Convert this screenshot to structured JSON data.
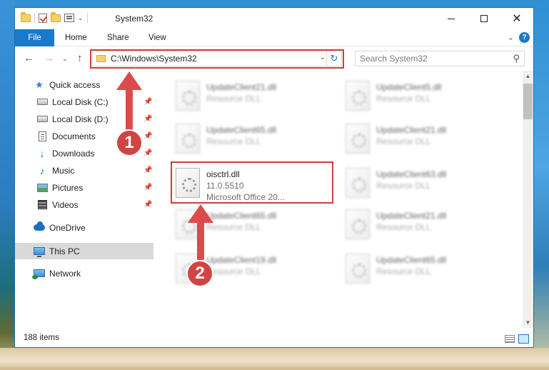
{
  "window": {
    "title": "System32",
    "minimize_glyph": "",
    "maximize_glyph": "",
    "close_glyph": "✕"
  },
  "ribbon": {
    "tabs": [
      {
        "label": "File",
        "active": true
      },
      {
        "label": "Home"
      },
      {
        "label": "Share"
      },
      {
        "label": "View"
      }
    ],
    "expand_glyph": "⌄",
    "help_glyph": "?"
  },
  "navigation": {
    "back_glyph": "←",
    "forward_glyph": "→",
    "recent_glyph": "⌄",
    "up_glyph": "↑",
    "address": "C:\\Windows\\System32",
    "address_dropdown_glyph": "⌄",
    "refresh_glyph": "↻",
    "search_placeholder": "Search System32",
    "search_glyph": "⚲"
  },
  "sidebar": {
    "items": [
      {
        "label": "Quick access",
        "icon": "star-icon"
      },
      {
        "label": "Local Disk (C:)",
        "icon": "drive-icon",
        "pinned": true
      },
      {
        "label": "Local Disk (D:)",
        "icon": "drive-icon",
        "pinned": true
      },
      {
        "label": "Documents",
        "icon": "documents-icon",
        "pinned": true
      },
      {
        "label": "Downloads",
        "icon": "download-arrow-icon",
        "pinned": true
      },
      {
        "label": "Music",
        "icon": "music-note-icon",
        "pinned": true
      },
      {
        "label": "Pictures",
        "icon": "pictures-icon",
        "pinned": true
      },
      {
        "label": "Videos",
        "icon": "videos-icon",
        "pinned": true
      },
      {
        "label": "OneDrive",
        "icon": "cloud-icon"
      },
      {
        "label": "This PC",
        "icon": "computer-icon",
        "selected": true
      },
      {
        "label": "Network",
        "icon": "network-icon"
      }
    ],
    "pin_glyph": "📌",
    "star_glyph": "★",
    "download_glyph": "↓",
    "music_glyph": "♪"
  },
  "files": {
    "left_column": [
      {
        "name": "UpdateClient21.dll",
        "type": "Resource DLL",
        "blurred": true
      },
      {
        "name": "UpdateClient65.dll",
        "type": "Resource DLL",
        "blurred": true
      },
      {
        "name": "oisctrl.dll",
        "version": "11.0.5510",
        "description": "Microsoft Office 20...",
        "blurred": false
      },
      {
        "name": "UpdateClient65.dll",
        "type": "Resource DLL",
        "blurred": true
      },
      {
        "name": "UpdateClient19.dll",
        "type": "Resource DLL",
        "blurred": true
      }
    ],
    "right_column": [
      {
        "name": "UpdateClient5.dll",
        "type": "Resource DLL",
        "blurred": true
      },
      {
        "name": "UpdateClient21.dll",
        "type": "Resource DLL",
        "blurred": true
      },
      {
        "name": "UpdateClient63.dll",
        "type": "Resource DLL",
        "blurred": true
      },
      {
        "name": "UpdateClient21.dll",
        "type": "Resource DLL",
        "blurred": true
      },
      {
        "name": "UpdateClient65.dll",
        "type": "Resource DLL",
        "blurred": true
      }
    ]
  },
  "scrollbar": {
    "up_glyph": "▲",
    "down_glyph": "▼"
  },
  "status": {
    "item_count": "188 items"
  },
  "annotations": {
    "step1": "1",
    "step2": "2",
    "highlight_color": "#d63b3b"
  }
}
